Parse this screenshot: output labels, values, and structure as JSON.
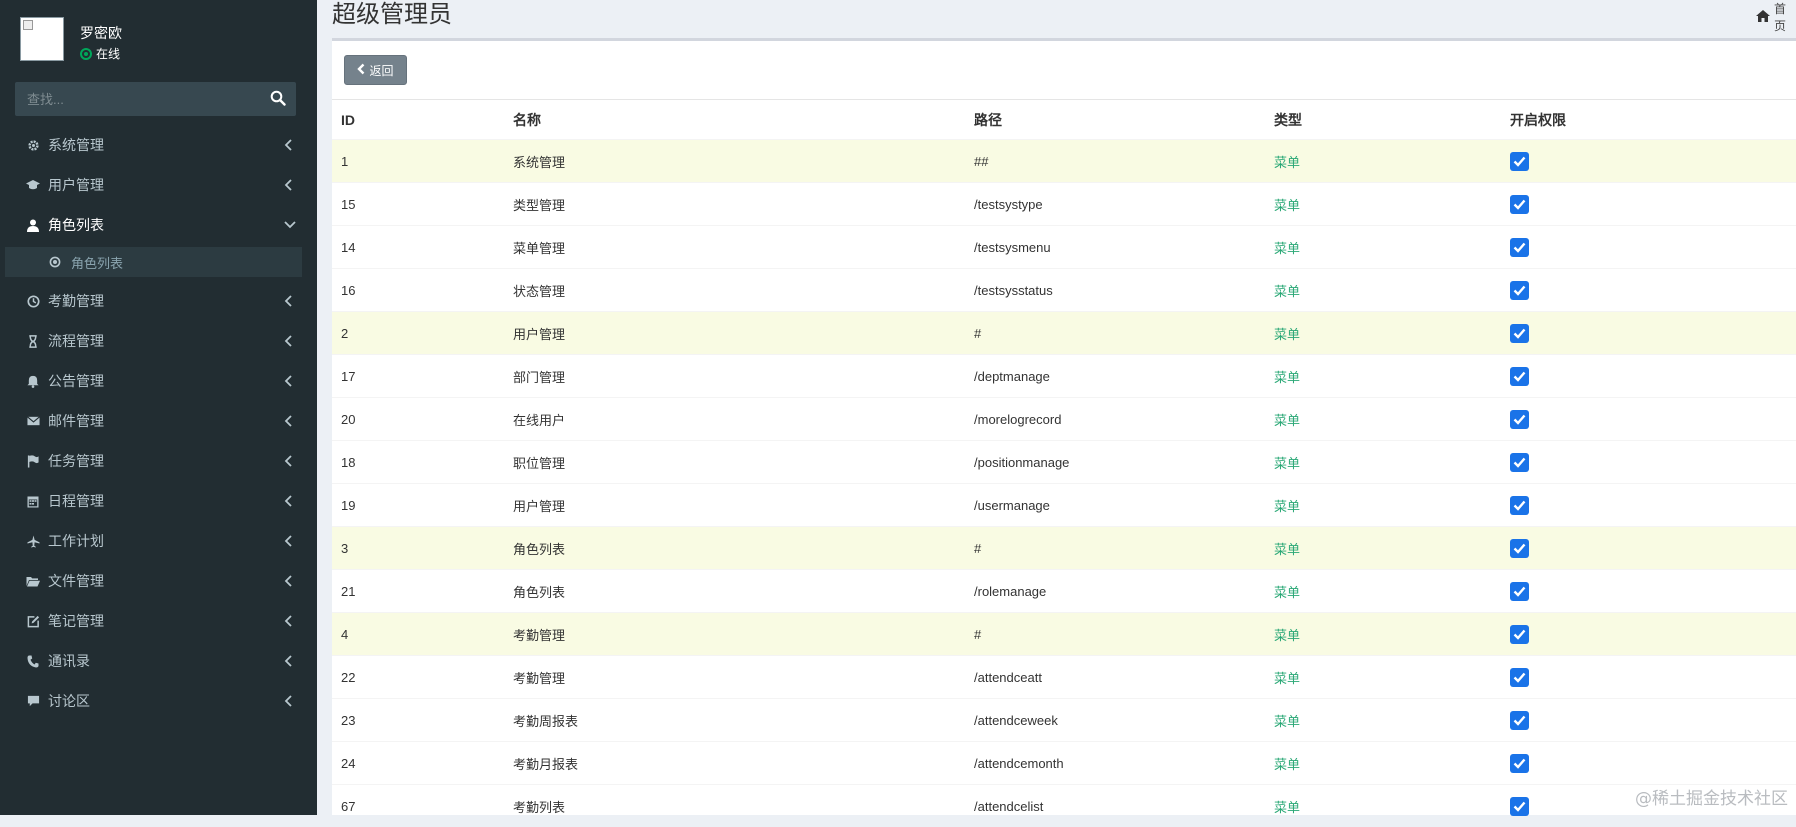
{
  "sidebar": {
    "user": {
      "name": "罗密欧",
      "status": "在线"
    },
    "search": {
      "placeholder": "查找..."
    },
    "items": [
      {
        "label": "系统管理",
        "icon": "gear-icon",
        "expanded": false
      },
      {
        "label": "用户管理",
        "icon": "graduation-cap-icon",
        "expanded": false
      },
      {
        "label": "角色列表",
        "icon": "user-icon",
        "expanded": true
      },
      {
        "label": "考勤管理",
        "icon": "clock-icon",
        "expanded": false
      },
      {
        "label": "流程管理",
        "icon": "hourglass-icon",
        "expanded": false
      },
      {
        "label": "公告管理",
        "icon": "bell-icon",
        "expanded": false
      },
      {
        "label": "邮件管理",
        "icon": "envelope-icon",
        "expanded": false
      },
      {
        "label": "任务管理",
        "icon": "flag-icon",
        "expanded": false
      },
      {
        "label": "日程管理",
        "icon": "calendar-icon",
        "expanded": false
      },
      {
        "label": "工作计划",
        "icon": "plane-icon",
        "expanded": false
      },
      {
        "label": "文件管理",
        "icon": "folder-open-icon",
        "expanded": false
      },
      {
        "label": "笔记管理",
        "icon": "edit-icon",
        "expanded": false
      },
      {
        "label": "通讯录",
        "icon": "phone-icon",
        "expanded": false
      },
      {
        "label": "讨论区",
        "icon": "comment-icon",
        "expanded": false
      }
    ],
    "subitem": {
      "label": "角色列表",
      "icon": "circle-dot-icon"
    }
  },
  "header": {
    "title": "超级管理员",
    "home_label": "首页"
  },
  "toolbar": {
    "back_label": "返回"
  },
  "table": {
    "columns": [
      "ID",
      "名称",
      "路径",
      "类型",
      "开启权限"
    ],
    "rows": [
      {
        "id": "1",
        "name": "系统管理",
        "path": "##",
        "type": "菜单",
        "enabled": true,
        "parent": true
      },
      {
        "id": "15",
        "name": "类型管理",
        "path": "/testsystype",
        "type": "菜单",
        "enabled": true,
        "parent": false
      },
      {
        "id": "14",
        "name": "菜单管理",
        "path": "/testsysmenu",
        "type": "菜单",
        "enabled": true,
        "parent": false
      },
      {
        "id": "16",
        "name": "状态管理",
        "path": "/testsysstatus",
        "type": "菜单",
        "enabled": true,
        "parent": false
      },
      {
        "id": "2",
        "name": "用户管理",
        "path": "#",
        "type": "菜单",
        "enabled": true,
        "parent": true
      },
      {
        "id": "17",
        "name": "部门管理",
        "path": "/deptmanage",
        "type": "菜单",
        "enabled": true,
        "parent": false
      },
      {
        "id": "20",
        "name": "在线用户",
        "path": "/morelogrecord",
        "type": "菜单",
        "enabled": true,
        "parent": false
      },
      {
        "id": "18",
        "name": "职位管理",
        "path": "/positionmanage",
        "type": "菜单",
        "enabled": true,
        "parent": false
      },
      {
        "id": "19",
        "name": "用户管理",
        "path": "/usermanage",
        "type": "菜单",
        "enabled": true,
        "parent": false
      },
      {
        "id": "3",
        "name": "角色列表",
        "path": "#",
        "type": "菜单",
        "enabled": true,
        "parent": true
      },
      {
        "id": "21",
        "name": "角色列表",
        "path": "/rolemanage",
        "type": "菜单",
        "enabled": true,
        "parent": false
      },
      {
        "id": "4",
        "name": "考勤管理",
        "path": "#",
        "type": "菜单",
        "enabled": true,
        "parent": true
      },
      {
        "id": "22",
        "name": "考勤管理",
        "path": "/attendceatt",
        "type": "菜单",
        "enabled": true,
        "parent": false
      },
      {
        "id": "23",
        "name": "考勤周报表",
        "path": "/attendceweek",
        "type": "菜单",
        "enabled": true,
        "parent": false
      },
      {
        "id": "24",
        "name": "考勤月报表",
        "path": "/attendcemonth",
        "type": "菜单",
        "enabled": true,
        "parent": false
      },
      {
        "id": "67",
        "name": "考勤列表",
        "path": "/attendcelist",
        "type": "菜单",
        "enabled": true,
        "parent": false
      }
    ]
  },
  "watermark": "@稀土掘金技术社区",
  "colors": {
    "sidebar_bg": "#222d32",
    "sidebar_active_bg": "#2c3b41",
    "parent_row_bg": "#f9fbe3",
    "type_text": "#2aa876",
    "checkbox": "#1a73e8",
    "back_button": "#75828c",
    "online": "#00a65a"
  }
}
